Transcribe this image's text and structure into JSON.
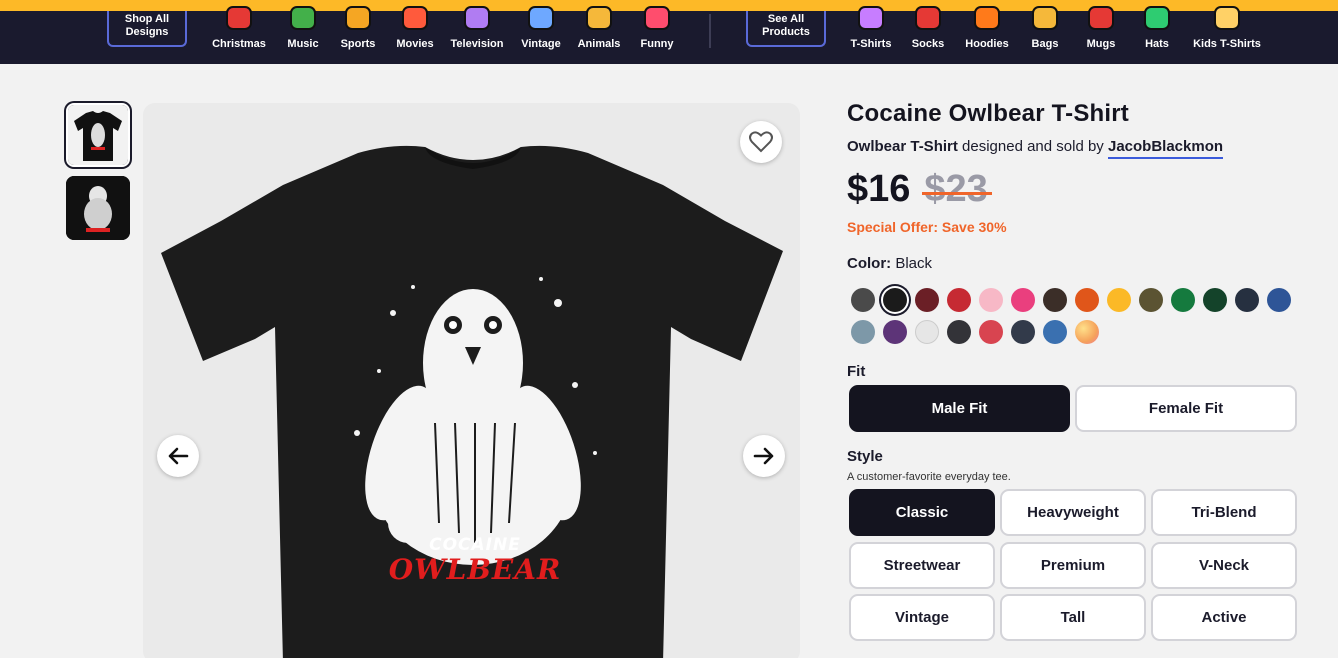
{
  "nav": {
    "shop_all": [
      "Shop All",
      "Designs"
    ],
    "see_all": [
      "See All",
      "Products"
    ],
    "categories": [
      {
        "label": "Christmas",
        "icon": "christmas-icon",
        "color": "#e53935"
      },
      {
        "label": "Music",
        "icon": "music-icon",
        "color": "#43b04a"
      },
      {
        "label": "Sports",
        "icon": "sports-icon",
        "color": "#f5a623"
      },
      {
        "label": "Movies",
        "icon": "movies-icon",
        "color": "#ff5a3c"
      },
      {
        "label": "Television",
        "icon": "television-icon",
        "color": "#b07cf2"
      },
      {
        "label": "Vintage",
        "icon": "vintage-icon",
        "color": "#6ea8ff"
      },
      {
        "label": "Animals",
        "icon": "animals-icon",
        "color": "#f5b83a"
      },
      {
        "label": "Funny",
        "icon": "funny-icon",
        "color": "#ff4d6d"
      }
    ],
    "products": [
      {
        "label": "T-Shirts",
        "icon": "tshirt-icon",
        "color": "#c77dff"
      },
      {
        "label": "Socks",
        "icon": "socks-icon",
        "color": "#e53935"
      },
      {
        "label": "Hoodies",
        "icon": "hoodie-icon",
        "color": "#ff7a1a"
      },
      {
        "label": "Bags",
        "icon": "bag-icon",
        "color": "#f5b83a"
      },
      {
        "label": "Mugs",
        "icon": "mug-icon",
        "color": "#e53935"
      },
      {
        "label": "Hats",
        "icon": "hat-icon",
        "color": "#2ecc71"
      },
      {
        "label": "Kids T-Shirts",
        "icon": "kids-tshirt-icon",
        "color": "#ffd166"
      }
    ]
  },
  "product": {
    "title": "Cocaine Owlbear T-Shirt",
    "subtitle_product": "Owlbear T-Shirt",
    "subtitle_mid": " designed and sold by ",
    "artist": "JacobBlackmon",
    "price": "$16",
    "old_price": "$23",
    "offer": "Special Offer: Save 30%",
    "design_text_top": "COCAINE",
    "design_text_bottom": "OWLBEAR"
  },
  "color": {
    "label": "Color:",
    "selected": "Black",
    "swatches": [
      "#4a4a4a",
      "#1b1b1b",
      "#6b1f26",
      "#c62a33",
      "#f7b8c6",
      "#ea3f7e",
      "#3b2e28",
      "#e0561a",
      "#fbb927",
      "#5b5332",
      "#157a3e",
      "#14432a",
      "#263040",
      "#2e5597",
      "#7d98a8",
      "#5d3478",
      "#e6e6e6",
      "#333338",
      "#d84450",
      "#323a4a",
      "#3a70b0",
      "#f5c26b"
    ]
  },
  "fit": {
    "label": "Fit",
    "options": [
      "Male Fit",
      "Female Fit"
    ],
    "selected": "Male Fit"
  },
  "style": {
    "label": "Style",
    "description": "A customer-favorite everyday tee.",
    "options": [
      "Classic",
      "Heavyweight",
      "Tri-Blend",
      "Streetwear",
      "Premium",
      "V-Neck",
      "Vintage",
      "Tall",
      "Active"
    ],
    "selected": "Classic"
  }
}
